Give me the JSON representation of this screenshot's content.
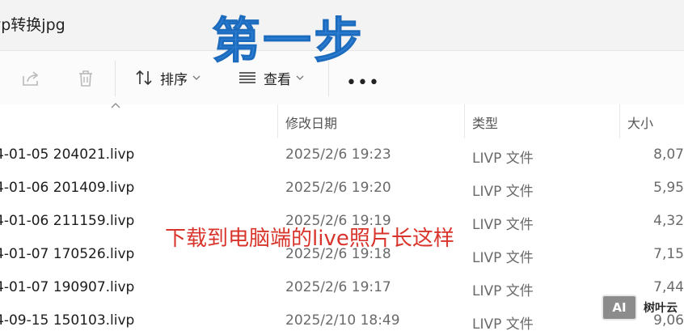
{
  "window": {
    "title": "vp转换jpg"
  },
  "toolbar": {
    "sort_label": "排序",
    "view_label": "查看",
    "more_label": "•••"
  },
  "columns": {
    "date": "修改日期",
    "type": "类型",
    "size": "大小"
  },
  "files": [
    {
      "name": "4-01-05 204021.livp",
      "date": "2025/2/6 19:23",
      "type": "LIVP 文件",
      "size": "8,07"
    },
    {
      "name": "4-01-06 201409.livp",
      "date": "2025/2/6 19:20",
      "type": "LIVP 文件",
      "size": "5,95"
    },
    {
      "name": "4-01-06 211159.livp",
      "date": "2025/2/6 19:19",
      "type": "LIVP 文件",
      "size": "4,32"
    },
    {
      "name": "4-01-07 170526.livp",
      "date": "2025/2/6 19:18",
      "type": "LIVP 文件",
      "size": "7,15"
    },
    {
      "name": "4-01-07 190907.livp",
      "date": "2025/2/6 19:17",
      "type": "LIVP 文件",
      "size": "7,44"
    },
    {
      "name": "4-09-15 150103.livp",
      "date": "2025/2/10 18:49",
      "type": "LIVP 文件",
      "size": "9,06"
    }
  ],
  "annotations": {
    "step_title": "第一步",
    "caption": "下载到电脑端的live照片长这样"
  },
  "watermark": {
    "logo": "AI",
    "text": "树叶云"
  },
  "colors": {
    "step_title": "#2d7fd6",
    "caption": "#d9342b",
    "titlebar_bg": "#f3f3f3"
  }
}
